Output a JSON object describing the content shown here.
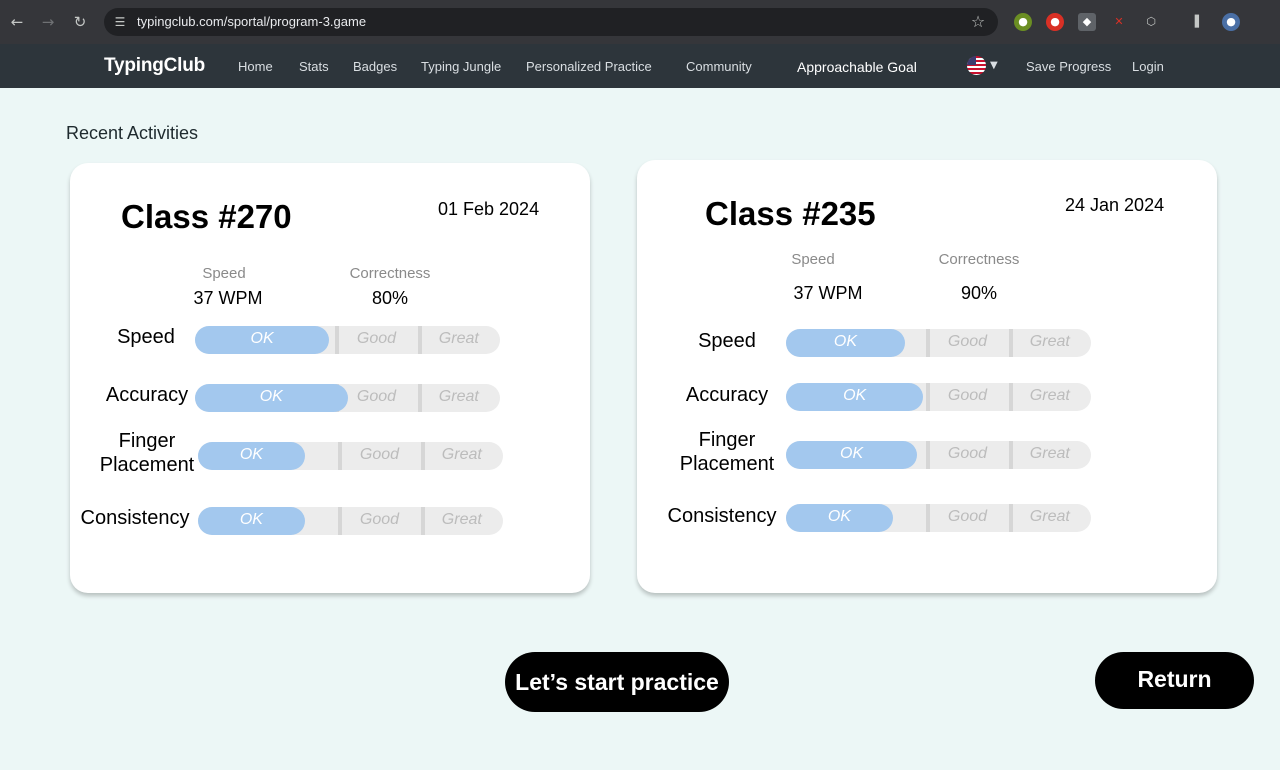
{
  "browser": {
    "url": "typingclub.com/sportal/program-3.game"
  },
  "site": {
    "logo": "TypingClub",
    "nav": [
      "Home",
      "Stats",
      "Badges",
      "Typing Jungle",
      "Personalized Practice",
      "Community"
    ],
    "goal": "Approachable Goal",
    "save": "Save Progress",
    "login": "Login"
  },
  "section_title": "Recent Activities",
  "scale": {
    "ok": "OK",
    "good": "Good",
    "great": "Great"
  },
  "cards": [
    {
      "title": "Class #270",
      "date": "01 Feb 2024",
      "speed_label": "Speed",
      "speed_value": "37 WPM",
      "correctness_label": "Correctness",
      "correctness_value": "80%",
      "metrics": [
        {
          "label": "Speed",
          "level": 0.44
        },
        {
          "label": "Accuracy",
          "level": 0.5
        },
        {
          "label": "Finger",
          "label2": "Placement",
          "level": 0.35
        },
        {
          "label": "Consistency",
          "level": 0.35
        }
      ]
    },
    {
      "title": "Class #235",
      "date": "24 Jan 2024",
      "speed_label": "Speed",
      "speed_value": "37 WPM",
      "correctness_label": "Correctness",
      "correctness_value": "90%",
      "metrics": [
        {
          "label": "Speed",
          "level": 0.39
        },
        {
          "label": "Accuracy",
          "level": 0.45
        },
        {
          "label": "Finger",
          "label2": "Placement",
          "level": 0.43
        },
        {
          "label": "Consistency",
          "level": 0.35
        }
      ]
    }
  ],
  "buttons": {
    "practice": "Let’s start practice",
    "return": "Return"
  },
  "colors": {
    "bar_fill": "#a3c8ee",
    "page_bg": "#ecf7f6",
    "nav_bg": "#2d353b"
  }
}
